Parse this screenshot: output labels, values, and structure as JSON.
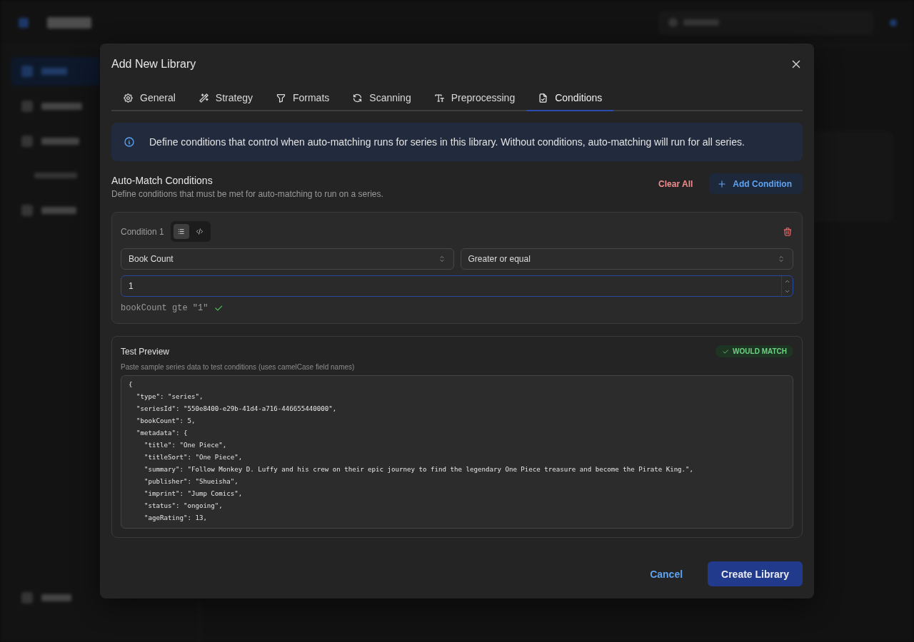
{
  "app": {
    "sidebar": {
      "items": [
        {
          "kind": "link",
          "selected": true
        },
        {
          "kind": "link",
          "selected": false
        },
        {
          "kind": "link",
          "selected": false
        },
        {
          "kind": "note"
        },
        {
          "kind": "link",
          "selected": false
        }
      ]
    }
  },
  "dialog": {
    "title": "Add New Library",
    "tabs": [
      {
        "label": "General",
        "selected": false
      },
      {
        "label": "Strategy",
        "selected": false
      },
      {
        "label": "Formats",
        "selected": false
      },
      {
        "label": "Scanning",
        "selected": false
      },
      {
        "label": "Preprocessing",
        "selected": false
      },
      {
        "label": "Conditions",
        "selected": true
      }
    ],
    "info": "Define conditions that control when auto-matching runs for series in this library. Without conditions, auto-matching will run for all series.",
    "section": {
      "title": "Auto-Match Conditions",
      "subtitle": "Define conditions that must be met for auto-matching to run on a series.",
      "clear_button": "Clear All",
      "add_button": "Add Condition"
    },
    "conditions": [
      {
        "label": "Condition 1",
        "modes": [
          {
            "kind": "list",
            "selected": true
          },
          {
            "kind": "code",
            "selected": false
          }
        ],
        "field": "Book Count",
        "operator": "Greater or equal",
        "value": "1",
        "expression": "bookCount gte \"1\"",
        "valid": true
      }
    ],
    "test_preview": {
      "title": "Test Preview",
      "badge": "WOULD MATCH",
      "matched": true,
      "hint": "Paste sample series data to test conditions (uses camelCase field names)",
      "sample": "{\n  \"type\": \"series\",\n  \"seriesId\": \"550e8400-e29b-41d4-a716-446655440000\",\n  \"bookCount\": 5,\n  \"metadata\": {\n    \"title\": \"One Piece\",\n    \"titleSort\": \"One Piece\",\n    \"summary\": \"Follow Monkey D. Luffy and his crew on their epic journey to find the legendary One Piece treasure and become the Pirate King.\",\n    \"publisher\": \"Shueisha\",\n    \"imprint\": \"Jump Comics\",\n    \"status\": \"ongoing\",\n    \"ageRating\": 13,"
    },
    "buttons": {
      "cancel": "Cancel",
      "submit": "Create Library"
    }
  }
}
